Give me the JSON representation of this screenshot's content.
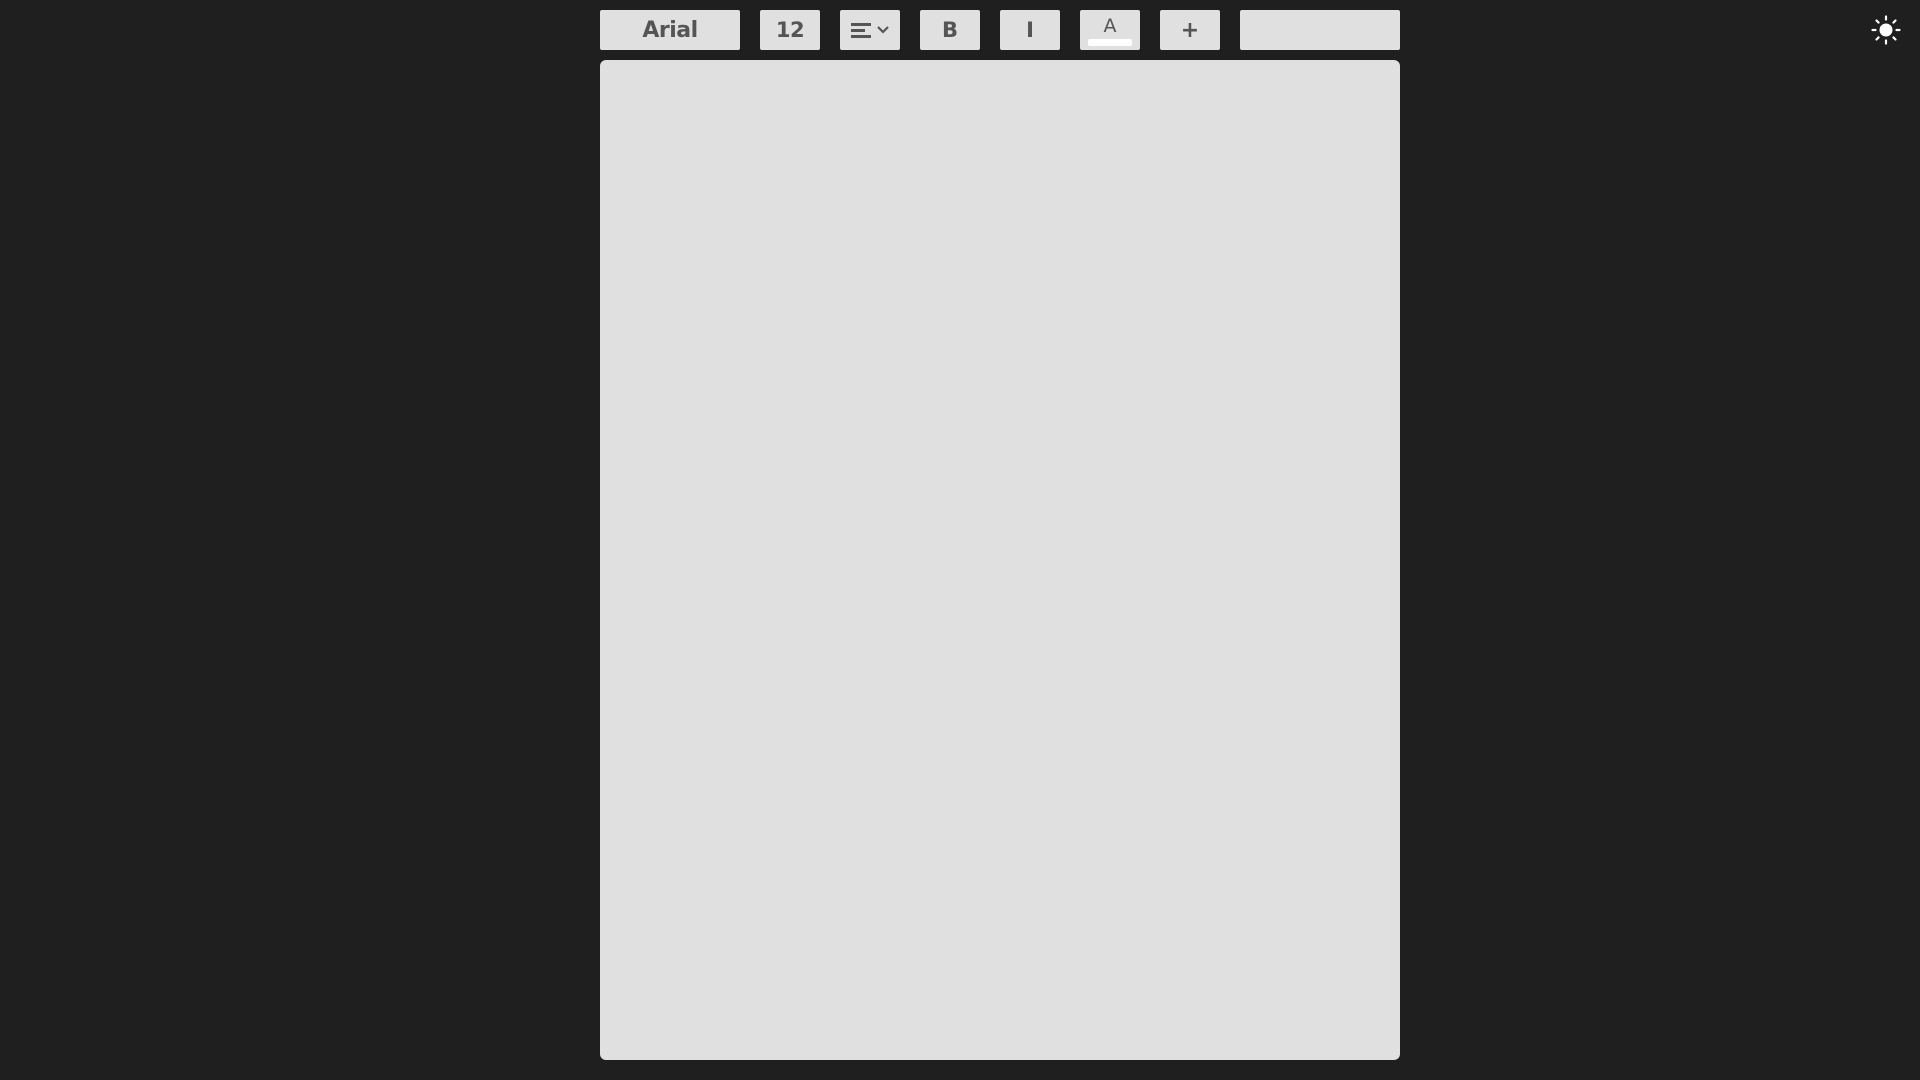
{
  "toolbar": {
    "font_family_value": "Arial",
    "font_size_value": "12",
    "align_icon": "align-left-icon",
    "bold_label": "B",
    "italic_label": "I",
    "text_color_label": "A",
    "text_color_swatch": "#ffffff",
    "add_label": "+",
    "field_value": ""
  },
  "editor": {
    "content": ""
  },
  "theme_toggle": {
    "icon": "sun-icon"
  },
  "colors": {
    "background": "#1f1f1f",
    "surface": "#e0e0e0",
    "control_text": "#555555",
    "icon_light": "#ffffff"
  }
}
